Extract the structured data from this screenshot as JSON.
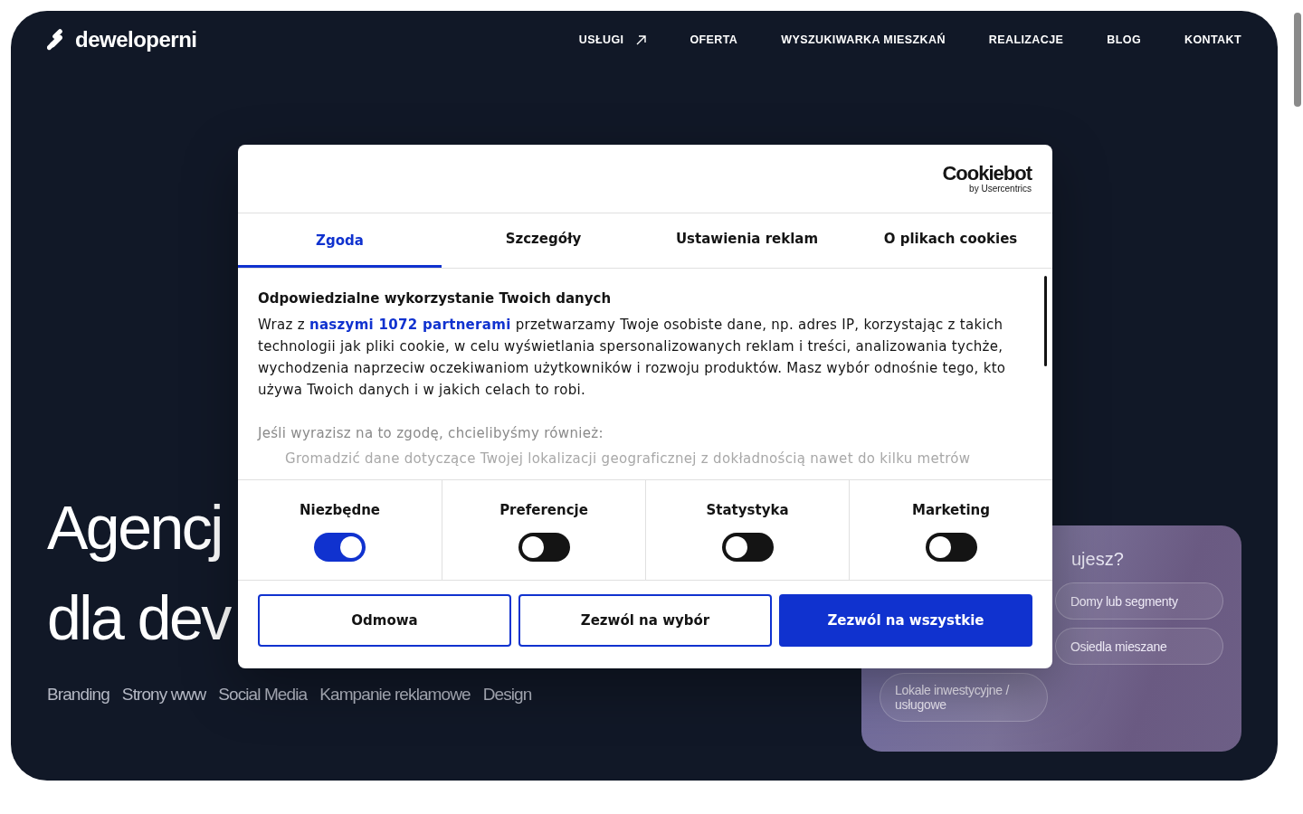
{
  "site": {
    "logo": "deweloperni",
    "nav": [
      {
        "label": "USŁUGI",
        "kind": "external"
      },
      {
        "label": "OFERTA",
        "kind": "plain"
      },
      {
        "label": "WYSZUKIWARKA MIESZKAŃ",
        "kind": "plain"
      },
      {
        "label": "REALIZACJE",
        "kind": "plain"
      },
      {
        "label": "BLOG",
        "kind": "plain"
      },
      {
        "label": "KONTAKT",
        "kind": "plain"
      }
    ],
    "headline": [
      "Agencj",
      "dla dev"
    ],
    "services": [
      "Branding",
      "Strony www",
      "Social Media",
      "Kampanie reklamowe",
      "Design"
    ],
    "finder": {
      "heading": "ujesz?",
      "options": [
        "Domy lub segmenty",
        "Osiedla mieszane",
        "Lokale inwestycyjne / usługowe"
      ]
    }
  },
  "consent": {
    "brand": {
      "name": "Cookiebot",
      "byline": "by Usercentrics"
    },
    "tabs": [
      {
        "label": "Zgoda",
        "selected": true
      },
      {
        "label": "Szczegóły",
        "selected": false
      },
      {
        "label": "Ustawienia reklam",
        "selected": false
      },
      {
        "label": "O plikach cookies",
        "selected": false
      }
    ],
    "title": "Odpowiedzialne wykorzystanie Twoich danych",
    "paragraph": {
      "before": "Wraz z ",
      "link": "naszymi 1072 partnerami",
      "after": " przetwarzamy Twoje osobiste dane, np. adres IP, korzystając z takich technologii jak pliki cookie, w celu wyświetlania spersonalizowanych reklam i treści, analizowania tychże, wychodzenia naprzeciw oczekiwaniom użytkowników i rozwoju produktów. Masz wybór odnośnie tego, kto używa Twoich danych i w jakich celach to robi."
    },
    "intro": "Jeśli wyrazisz na to zgodę, chcielibyśmy również:",
    "purposes": [
      "Gromadzić dane dotyczące Twojej lokalizacji geograficznej z dokładnością nawet do kilku metrów"
    ],
    "toggles": [
      {
        "label": "Niezbędne",
        "on": true
      },
      {
        "label": "Preferencje",
        "on": false
      },
      {
        "label": "Statystyka",
        "on": false
      },
      {
        "label": "Marketing",
        "on": false
      }
    ],
    "buttons": [
      {
        "label": "Odmowa",
        "kind": "outline"
      },
      {
        "label": "Zezwól na wybór",
        "kind": "outline"
      },
      {
        "label": "Zezwól na wszystkie",
        "kind": "primary"
      }
    ]
  }
}
